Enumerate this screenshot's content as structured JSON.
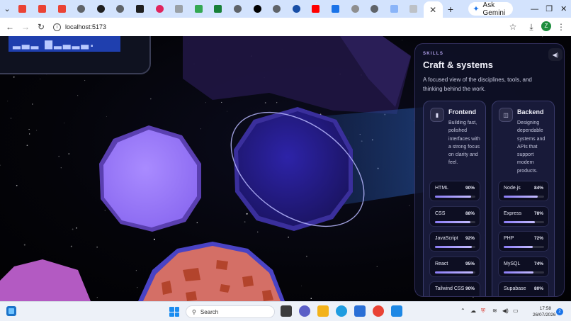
{
  "browser": {
    "tabs": [
      {
        "name": "gmail",
        "color": "#ea4335",
        "round": false
      },
      {
        "name": "gmail",
        "color": "#ea4335",
        "round": false
      },
      {
        "name": "gmail",
        "color": "#ea4335",
        "round": false
      },
      {
        "name": "globe",
        "color": "#5f6368",
        "round": true
      },
      {
        "name": "github",
        "color": "#1f1f1f",
        "round": true
      },
      {
        "name": "chat",
        "color": "#5f6368",
        "round": true
      },
      {
        "name": "site",
        "color": "#1f1f1f",
        "round": false
      },
      {
        "name": "app",
        "color": "#e0245e",
        "round": true
      },
      {
        "name": "site",
        "color": "#9aa0a6",
        "round": false
      },
      {
        "name": "map",
        "color": "#34a853",
        "round": false
      },
      {
        "name": "chart",
        "color": "#188038",
        "round": false
      },
      {
        "name": "gear",
        "color": "#5f6368",
        "round": true
      },
      {
        "name": "site",
        "color": "#000000",
        "round": true
      },
      {
        "name": "globe",
        "color": "#5f6368",
        "round": true
      },
      {
        "name": "site",
        "color": "#174ea6",
        "round": true
      },
      {
        "name": "youtube",
        "color": "#ff0000",
        "round": false
      },
      {
        "name": "app",
        "color": "#1a73e8",
        "round": false
      },
      {
        "name": "app",
        "color": "#8e8e8e",
        "round": true
      },
      {
        "name": "globe",
        "color": "#5f6368",
        "round": true
      },
      {
        "name": "app",
        "color": "#8ab4f8",
        "round": false
      },
      {
        "name": "app",
        "color": "#bdc1c6",
        "round": false
      }
    ],
    "active_tab_close": "✕",
    "new_tab": "+",
    "ask_gemini": "Ask Gemini",
    "url": "localhost:5173",
    "profile_initial": "Z"
  },
  "panel": {
    "eyebrow": "SKILLS",
    "title": "Craft & systems",
    "description": "A focused view of the disciplines, tools, and thinking behind the work.",
    "categories": [
      {
        "title": "Frontend",
        "description": "Building fast, polished interfaces with a strong focus on clarity and feel.",
        "skills": [
          {
            "name": "HTML",
            "percent_label": "90%",
            "value": 90
          },
          {
            "name": "CSS",
            "percent_label": "88%",
            "value": 88
          },
          {
            "name": "JavaScript",
            "percent_label": "92%",
            "value": 92
          },
          {
            "name": "React",
            "percent_label": "95%",
            "value": 95
          },
          {
            "name": "Tailwind CSS",
            "percent_label": "90%",
            "value": 90
          }
        ]
      },
      {
        "title": "Backend",
        "description": "Designing dependable systems and APIs that support modern products.",
        "skills": [
          {
            "name": "Node.js",
            "percent_label": "84%",
            "value": 84
          },
          {
            "name": "Express",
            "percent_label": "78%",
            "value": 78
          },
          {
            "name": "PHP",
            "percent_label": "72%",
            "value": 72
          },
          {
            "name": "MySQL",
            "percent_label": "74%",
            "value": 74
          },
          {
            "name": "Supabase",
            "percent_label": "80%",
            "value": 80
          }
        ]
      }
    ]
  },
  "taskbar": {
    "search_placeholder": "Search",
    "time": "17:58",
    "date": "26/07/2026",
    "notification_count": "2",
    "apps": [
      {
        "name": "task-view",
        "color": "#3c3c3c"
      },
      {
        "name": "teams",
        "color": "#5b5fc7"
      },
      {
        "name": "file-explorer",
        "color": "#f3b21a"
      },
      {
        "name": "edge",
        "color": "#1f9ce0"
      },
      {
        "name": "store",
        "color": "#2a6fd6"
      },
      {
        "name": "chrome",
        "color": "#e94335"
      },
      {
        "name": "vscode",
        "color": "#1e88e5"
      }
    ]
  }
}
